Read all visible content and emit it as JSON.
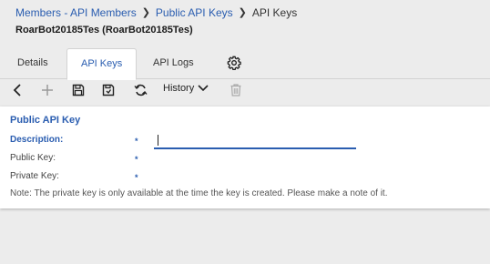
{
  "breadcrumb": {
    "items": [
      "Members - API Members",
      "Public API Keys",
      "API Keys"
    ]
  },
  "record_title": "RoarBot20185Tes (RoarBot20185Tes)",
  "tabs": {
    "details": "Details",
    "api_keys": "API Keys",
    "api_logs": "API Logs",
    "settings_icon": "gear-icon"
  },
  "toolbar": {
    "back_icon": "chevron-left-icon",
    "add_icon": "plus-icon",
    "save_icon": "save-icon",
    "save_close_icon": "save-close-icon",
    "refresh_icon": "refresh-icon",
    "history_label": "History",
    "delete_icon": "trash-icon"
  },
  "form": {
    "title": "Public API Key",
    "description_label": "Description:",
    "description_value": "",
    "public_key_label": "Public Key:",
    "private_key_label": "Private Key:",
    "required_marker": "*",
    "note": "Note: The private key is only available at the time the key is created. Please make a note of it."
  },
  "colors": {
    "accent": "#2a5db0",
    "background": "#ececec",
    "panel": "#ffffff"
  }
}
